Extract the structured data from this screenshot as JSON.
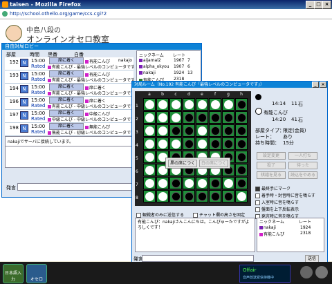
{
  "window": {
    "title": "taisen - Mozilla Firefox",
    "url": "http://school.othello.org/game/ccs.cgi?2",
    "btn_min": "_",
    "btn_max": "□",
    "btn_close": "×"
  },
  "header": {
    "line1": "中島八段の",
    "line2": "オンラインオセロ教室"
  },
  "lobby": {
    "title": "自由対局ロビー",
    "col_room": "部屋",
    "col_time": "時間",
    "col_black": "黒番",
    "col_white": "白番",
    "rooms": [
      {
        "no": "192",
        "time": "15:00",
        "rated": "Rated",
        "black_btn": "席に着く",
        "white": "有能こんぴ",
        "white_extra": "nakajo",
        "line2": "有能こんぴ - 最強レベルのコンピュータです"
      },
      {
        "no": "193",
        "time": "15:00",
        "rated": "Rated",
        "black_btn": "席に着く",
        "white": "有能こんぴ",
        "white_extra": "",
        "line2": "有能こんぴ - 最強レベルのコンピュータです"
      },
      {
        "no": "194",
        "time": "15:00",
        "rated": "Rated",
        "black_btn": "席に着く",
        "white": "席に着く",
        "white_extra": "",
        "line2": "有能こんぴ - 最強レベルのコンピュータです"
      },
      {
        "no": "196",
        "time": "15:00",
        "rated": "Rated",
        "black_btn": "席に着く",
        "white": "席に着く",
        "white_extra": "",
        "line2": "有能こんぴ - 中級レベルのコンピュータです"
      },
      {
        "no": "197",
        "time": "15:00",
        "rated": "Rated",
        "black_btn": "席に着く",
        "white": "中級こんぴ",
        "white_extra": "",
        "line2": "中級こんぴ - 中級レベルのコンピュータです"
      },
      {
        "no": "198",
        "time": "15:00",
        "rated": "Rated",
        "black_btn": "席に着く",
        "white": "無能こんぴ",
        "white_extra": "",
        "line2": "無能こんぴ - 初級レベルのコンピュータです"
      }
    ],
    "players_header": {
      "name": "ニックネーム",
      "rate": "レート"
    },
    "players": [
      {
        "name": "aijamal2",
        "rate": "1967",
        "rank": "7"
      },
      {
        "name": "alpha_okyou",
        "rate": "1907",
        "rank": "6"
      },
      {
        "name": "nakaji",
        "rate": "1924",
        "rank": "13"
      },
      {
        "name": "有能こんぴ",
        "rate": "2318",
        "rank": ""
      }
    ],
    "log": "nakajiでサーバに接続しています。",
    "speak_label": "発言",
    "send_btn": "送信"
  },
  "game": {
    "title": "対局ルーム（No.192 有能こんぴ「最強レベルのコンピュータです」）",
    "cols": [
      "a",
      "b",
      "c",
      "d",
      "e",
      "f",
      "g",
      "h"
    ],
    "rows": [
      "1",
      "2",
      "3",
      "4",
      "5",
      "6",
      "7",
      "8"
    ],
    "board": [
      "wwwwwwwb",
      "wwwbbbbb",
      "wwbbwbbb",
      "wwwbwbbb",
      "wwbbwwbb",
      "wwwbwwbb",
      "wwbwwbwb",
      "wwbbbbbw"
    ],
    "popup_black": "黒の席につく",
    "popup_white": "白の席につく",
    "player_black": {
      "time": "14:14",
      "stones": "11",
      "unit": "石"
    },
    "player_white": {
      "name": "有能こんぴ",
      "time": "14:20",
      "stones": "41",
      "unit": "石"
    },
    "room_type_label": "部屋タイプ：",
    "room_type": "限定(会員)",
    "rate_label": "レート：",
    "rate": "あり",
    "time_label": "持ち時間：",
    "time": "15分",
    "btns": [
      "設定変更",
      "一人打ち",
      "投了",
      "待った",
      "棋譜を見る",
      "読込をやめる"
    ],
    "options": [
      {
        "label": "最終手にマーク",
        "checked": true
      },
      {
        "label": "着手時・封音時に音を鳴らす",
        "checked": false
      },
      {
        "label": "入室時に音を鳴らす",
        "checked": false
      },
      {
        "label": "盤面を上下反転表示",
        "checked": false
      },
      {
        "label": "発言時に音を鳴らす",
        "checked": false
      }
    ],
    "watch_only": "観戦者のみに送信する",
    "chat_fixed": "チャット欄の高さを固定",
    "chat": "有能こんぴ：nakajiさんこんにちは。こんぴゅーたですがよろしくです！",
    "plist_header": {
      "name": "ニックネーム",
      "rate": "レート"
    },
    "plist": [
      {
        "name": "nakaji",
        "rate": "1924"
      },
      {
        "name": "有能こんぴ",
        "rate": "2318"
      }
    ],
    "speak_label": "発言",
    "send_btn": "送信"
  },
  "taskbar": {
    "app1": "日本語入力",
    "app2": "オセロ",
    "status": "Offair",
    "status2": "音声放送受信待機中"
  }
}
